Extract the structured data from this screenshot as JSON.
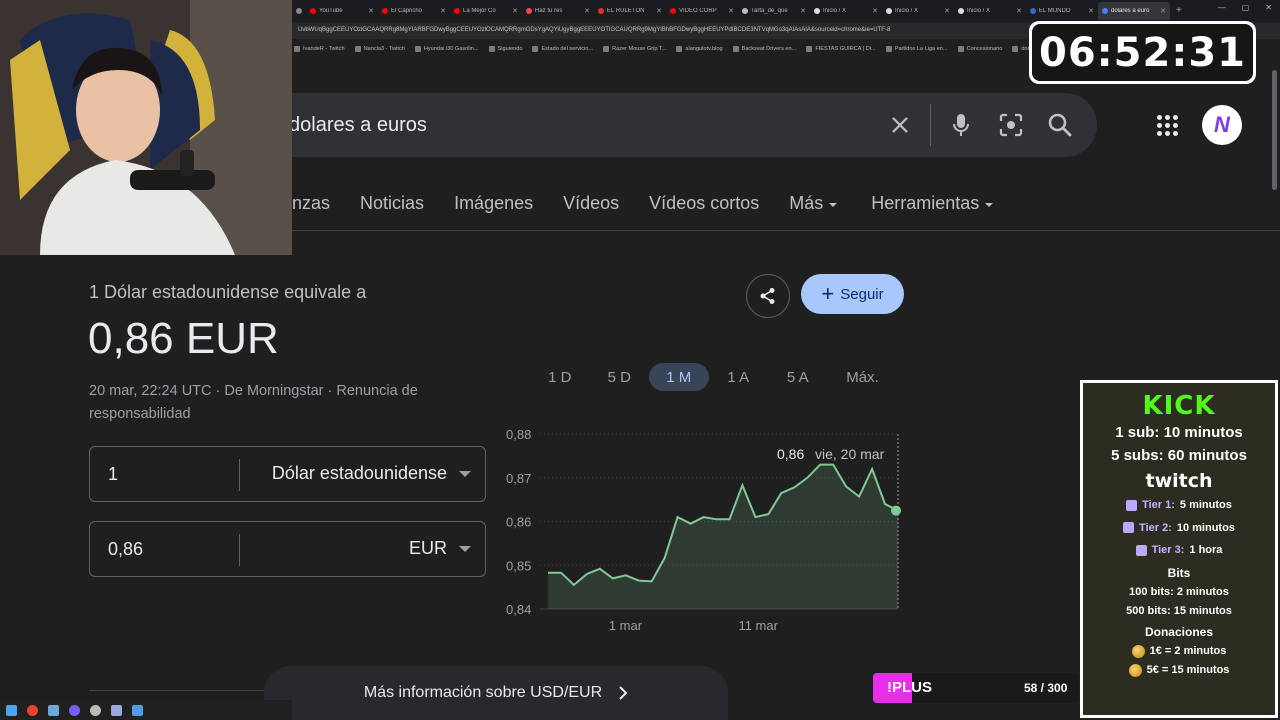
{
  "browser": {
    "tabs": [
      {
        "label": "",
        "color": "#888888"
      },
      {
        "label": "YouTube",
        "color": "#ff0000"
      },
      {
        "label": "El Capricho",
        "color": "#ff0000"
      },
      {
        "label": "La Mejor Co",
        "color": "#ff0000"
      },
      {
        "label": "Haz tu res",
        "color": "#ff4444"
      },
      {
        "label": "EL RULETÓN",
        "color": "#e03030"
      },
      {
        "label": "VÍDEO CORP",
        "color": "#ff0000"
      },
      {
        "label": "Tarta_de_que",
        "color": "#bbbbbb"
      },
      {
        "label": "Inicio / X",
        "color": "#dddddd"
      },
      {
        "label": "Inicio / X",
        "color": "#dddddd"
      },
      {
        "label": "Inicio / X",
        "color": "#dddddd"
      },
      {
        "label": "EL MUNDO",
        "color": "#2a6ebb"
      },
      {
        "label": "dolares a euro",
        "color": "#4285f4"
      }
    ],
    "active_tab_index": 12,
    "url": "UvbWUqBggCEEUYOzlGCAAQRRg8MgYIARBFGDwyBggCEEUYOzlOCAMQRRgmGDsYgAQYiUgyBggEEEUYOTIGCAUQRRg9MgYIBhBFGDwyBggHEEUYPdIBCDE3NTVqMGo3qAIAsAIA&sourceid=chrome&ie=UTF-8",
    "bookmarks": [
      "IvandeR - Twitch",
      "Nancla3 - Twitch",
      "Hyundai i30 Gasolin...",
      "Siguiendo",
      "Estado del servicio...",
      "Razer Mouse Grip T...",
      "alangulotv.blog",
      "Backseat Drivers en...",
      "FIESTAS GUIRCA | Di...",
      "Partidos La Liga en...",
      "Concesionario",
      "dores"
    ]
  },
  "search": {
    "query": "dolares a euros",
    "avatar_letter": "N",
    "tabs": [
      {
        "label": "nzas",
        "dropdown": false
      },
      {
        "label": "Noticias",
        "dropdown": false
      },
      {
        "label": "Imágenes",
        "dropdown": false
      },
      {
        "label": "Vídeos",
        "dropdown": false
      },
      {
        "label": "Vídeos cortos",
        "dropdown": false
      },
      {
        "label": "Más",
        "dropdown": true
      },
      {
        "label": "Herramientas",
        "dropdown": true
      }
    ]
  },
  "converter": {
    "equiv_label": "1 Dólar estadounidense equivale a",
    "value": "0,86 EUR",
    "source_line": "20 mar, 22:24 UTC · De Morningstar · Renuncia de responsabilidad",
    "from_amount": "1",
    "from_currency": "Dólar estadounidense",
    "to_amount": "0,86",
    "to_currency": "EUR",
    "follow_label": "Seguir",
    "ranges": [
      "1 D",
      "5 D",
      "1 M",
      "1 A",
      "5 A",
      "Máx."
    ],
    "active_range": "1 M",
    "more_info": "Más información sobre USD/EUR"
  },
  "chart_data": {
    "type": "area",
    "y_ticks": [
      "0,88",
      "0,87",
      "0,86",
      "0,85",
      "0,84"
    ],
    "ylim": [
      0.84,
      0.88
    ],
    "x_tick_labels": [
      "1 mar",
      "11 mar"
    ],
    "tooltip_value": "0,86",
    "tooltip_date": "vie, 20 mar",
    "line_color": "#81c995",
    "values": [
      0.8483,
      0.8483,
      0.8455,
      0.848,
      0.8492,
      0.847,
      0.8477,
      0.8465,
      0.8463,
      0.8517,
      0.861,
      0.8595,
      0.861,
      0.8605,
      0.8605,
      0.8683,
      0.861,
      0.8617,
      0.8665,
      0.8678,
      0.87,
      0.873,
      0.873,
      0.868,
      0.8657,
      0.872,
      0.864,
      0.8625
    ]
  },
  "overlay": {
    "timer": "06:52:31",
    "kick_title": "KICK",
    "kick_lines": [
      "1 sub: 10 minutos",
      "5 subs: 60 minutos"
    ],
    "twitch_title": "twitch",
    "tiers": [
      {
        "name": "Tier 1:",
        "value": "5 minutos"
      },
      {
        "name": "Tier 2:",
        "value": "10 minutos"
      },
      {
        "name": "Tier 3:",
        "value": "1 hora"
      }
    ],
    "bits_title": "Bits",
    "bits_lines": [
      "100 bits: 2 minutos",
      "500 bits: 15 minutos"
    ],
    "donations_title": "Donaciones",
    "donation_lines": [
      "1€ = 2 minutos",
      "5€ = 15 minutos"
    ],
    "plus_label": "!PLUS",
    "plus_count": "58 / 300",
    "plus_progress": 0.19
  }
}
